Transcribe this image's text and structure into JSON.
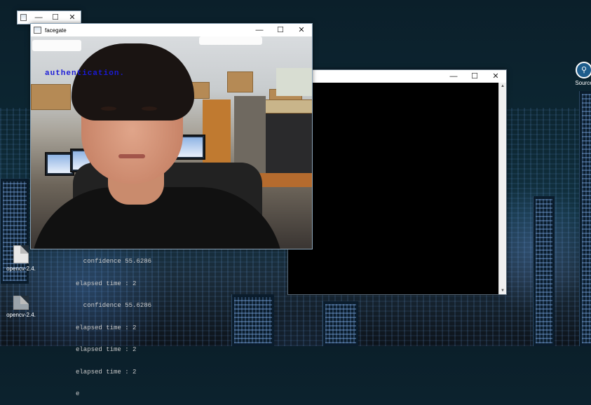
{
  "desktop": {
    "icons": [
      {
        "label": "opencv-2.4."
      },
      {
        "label": "opencv-2.4."
      }
    ],
    "source_icon_label": "Source"
  },
  "tiny_window": {
    "title": "",
    "ctl_min": "—",
    "ctl_max": "☐",
    "ctl_close": "✕"
  },
  "console_window": {
    "title": "",
    "ctl_min": "—",
    "ctl_max": "☐",
    "ctl_close": "✕",
    "lines": [
      "  confidence 55.6286",
      "elapsed time : 2",
      "  confidence 55.6286",
      "elapsed time : 2",
      "elapsed time : 2",
      "elapsed time : 2",
      "e"
    ]
  },
  "facegate_window": {
    "title": "facegate",
    "ctl_min": "—",
    "ctl_max": "☐",
    "ctl_close": "✕",
    "overlay_text": "authentication."
  }
}
